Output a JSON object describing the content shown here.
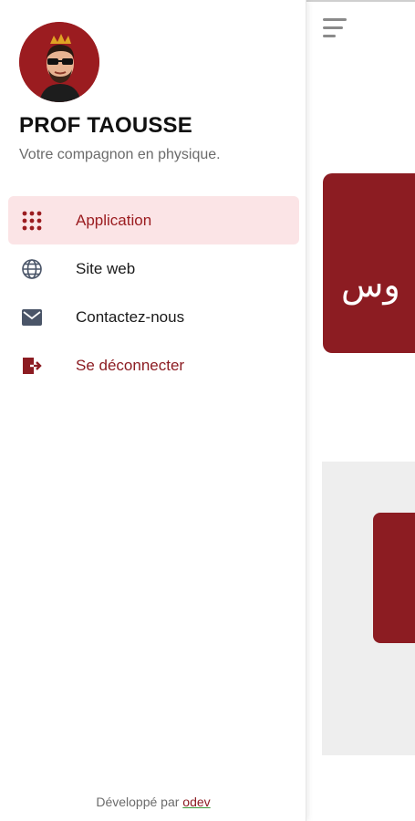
{
  "background": {
    "banner_text": "وس"
  },
  "drawer": {
    "title": "PROF TAOUSSE",
    "subtitle": "Votre compagnon en physique.",
    "items": [
      {
        "label": "Application",
        "icon": "apps-grid-icon",
        "active": true
      },
      {
        "label": "Site web",
        "icon": "globe-icon",
        "active": false
      },
      {
        "label": "Contactez-nous",
        "icon": "mail-icon",
        "active": false
      },
      {
        "label": "Se déconnecter",
        "icon": "logout-icon",
        "active": false
      }
    ],
    "footer": {
      "prefix": "Développé par ",
      "link": "odev"
    }
  },
  "colors": {
    "brand": "#8c1c22",
    "active_bg": "#fbe4e6",
    "text": "#1a1a1a",
    "muted": "#6b6b6b"
  }
}
